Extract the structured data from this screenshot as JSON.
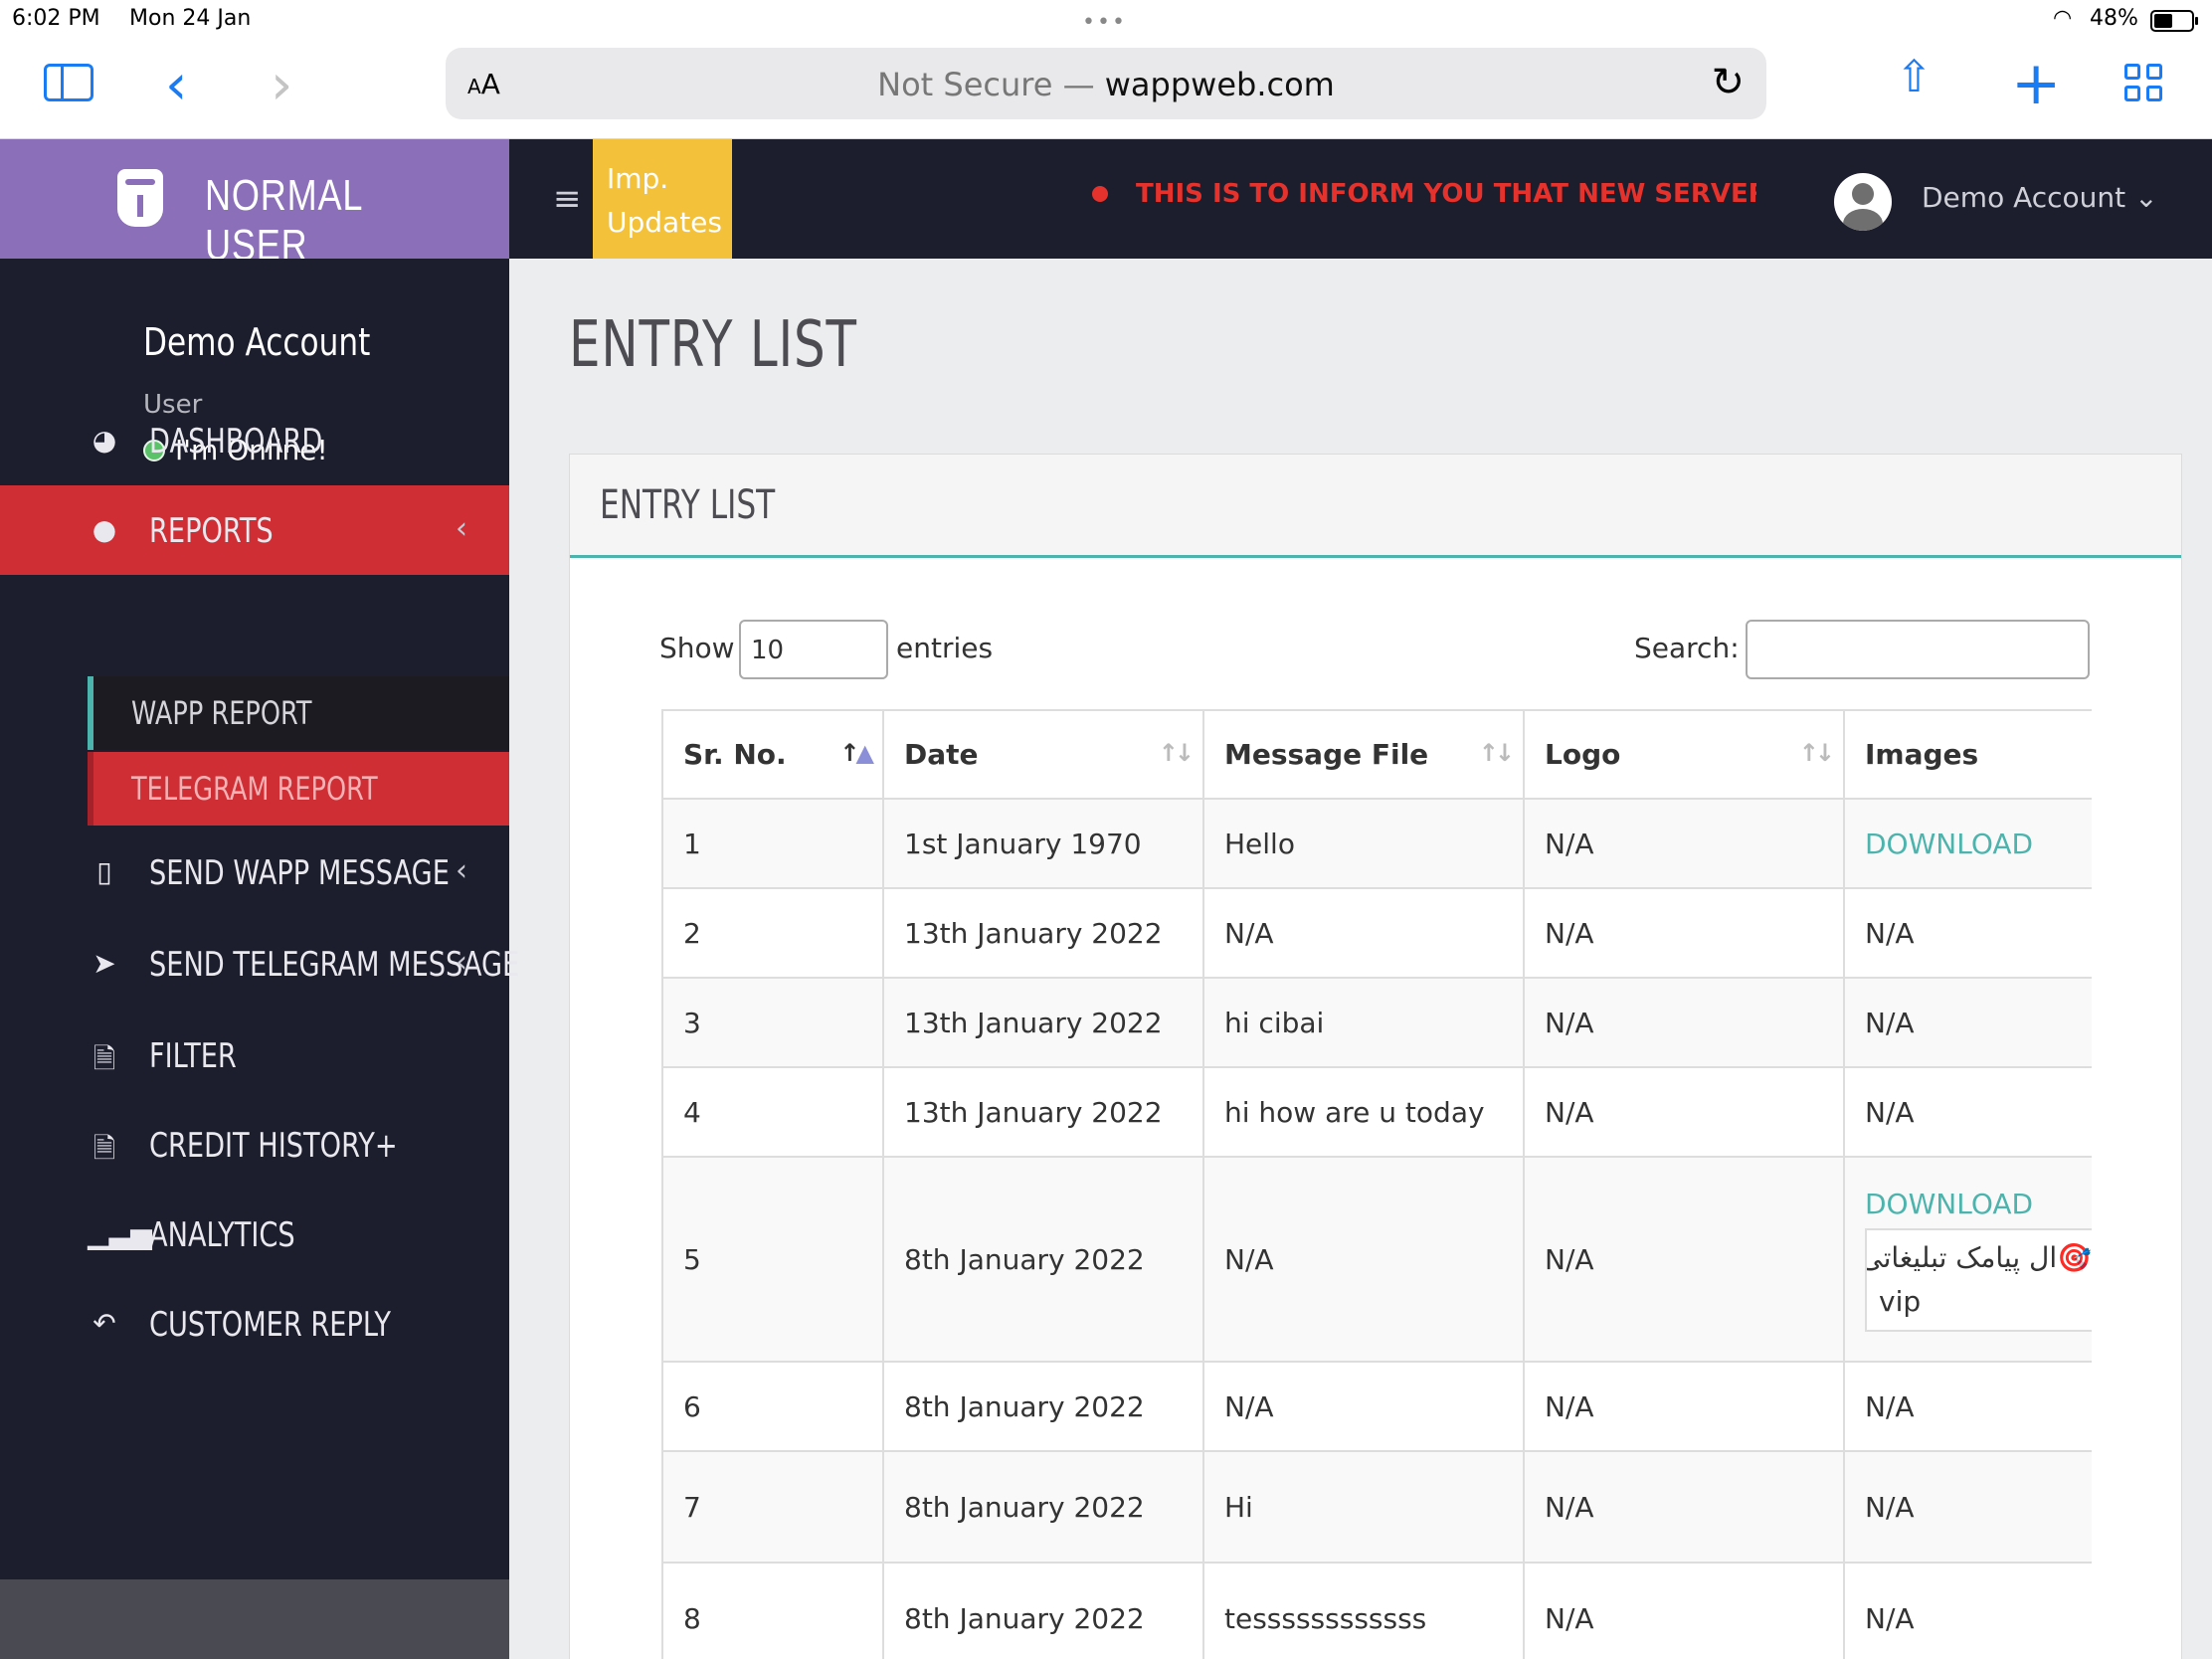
{
  "status": {
    "time": "6:02 PM",
    "date": "Mon 24 Jan",
    "battery": "48%"
  },
  "browser": {
    "aa": "AA",
    "url_prefix": "Not Secure — ",
    "url_host": "wappweb.com"
  },
  "header": {
    "brand": "NORMAL USER",
    "imp_updates": "Imp. Updates",
    "marquee": "THIS IS TO INFORM YOU THAT NEW SERVER IS",
    "user_name": "Demo Account"
  },
  "sidebar": {
    "name": "Demo Account",
    "role": "User",
    "online": "I'm Online!",
    "items": [
      {
        "label": "DASHBOARD",
        "icon": "dashboard-icon"
      },
      {
        "label": "REPORTS",
        "icon": "user-icon"
      },
      {
        "label": "WAPP REPORT"
      },
      {
        "label": "TELEGRAM REPORT"
      },
      {
        "label": "SEND WAPP MESSAGE",
        "icon": "mobile-icon"
      },
      {
        "label": "SEND TELEGRAM MESSAGE",
        "icon": "telegram-icon"
      },
      {
        "label": "FILTER",
        "icon": "file-icon"
      },
      {
        "label": "CREDIT HISTORY+",
        "icon": "file-icon"
      },
      {
        "label": "ANALYTICS",
        "icon": "bar-chart-icon"
      },
      {
        "label": "CUSTOMER REPLY",
        "icon": "reply-icon"
      }
    ]
  },
  "main": {
    "page_title": "ENTRY LIST",
    "card_title": "ENTRY LIST",
    "show_label": "Show",
    "show_value": "10",
    "entries_label": "entries",
    "search_label": "Search:",
    "columns": [
      "Sr. No.",
      "Date",
      "Message File",
      "Logo",
      "Images"
    ],
    "rows": [
      [
        "1",
        "1st January 1970",
        "Hello",
        "N/A",
        "DOWNLOAD"
      ],
      [
        "2",
        "13th January 2022",
        "N/A",
        "N/A",
        "N/A"
      ],
      [
        "3",
        "13th January 2022",
        "hi cibai",
        "N/A",
        "N/A"
      ],
      [
        "4",
        "13th January 2022",
        "hi how are u today",
        "N/A",
        "N/A"
      ],
      [
        "5",
        "8th January 2022",
        "N/A",
        "N/A",
        "DOWNLOAD"
      ],
      [
        "6",
        "8th January 2022",
        "N/A",
        "N/A",
        "N/A"
      ],
      [
        "7",
        "8th January 2022",
        "Hi",
        "N/A",
        "N/A"
      ],
      [
        "8",
        "8th January 2022",
        "tessssssssssss",
        "N/A",
        "N/A"
      ]
    ],
    "row5_image_text_line1": "🎯ال پیامک تبلیغاتی",
    "row5_image_text_line2": "vip"
  },
  "colors": {
    "accent": "#4cb4ad",
    "danger": "#cf2e35",
    "brand": "#8b6fb9",
    "warning": "#f3c13a",
    "dark": "#1c1e2e"
  }
}
